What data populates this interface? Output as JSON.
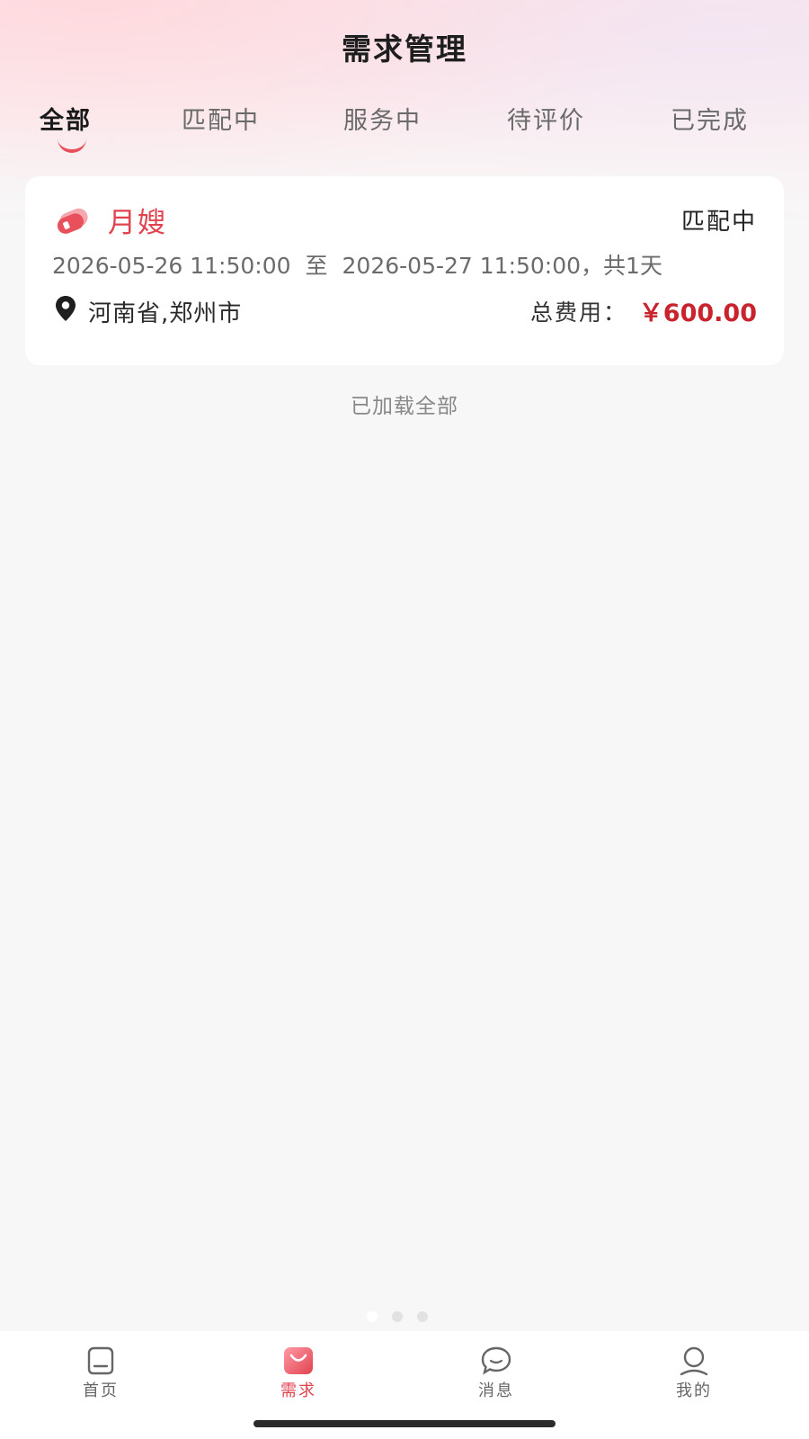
{
  "header": {
    "title": "需求管理"
  },
  "tabs": [
    {
      "label": "全部",
      "active": true
    },
    {
      "label": "匹配中",
      "active": false
    },
    {
      "label": "服务中",
      "active": false
    },
    {
      "label": "待评价",
      "active": false
    },
    {
      "label": "已完成",
      "active": false
    }
  ],
  "orders": [
    {
      "service_icon": "service-tag-icon",
      "service_name": "月嫂",
      "status": "匹配中",
      "start_time": "2026-05-26 11:50:00",
      "range_separator": "至",
      "end_time": "2026-05-27 11:50:00",
      "duration": "，共1天",
      "location_icon": "location-pin-icon",
      "location": "河南省,郑州市",
      "fee_label": "总费用：",
      "fee_value": "￥600.00"
    }
  ],
  "list_footer": "已加载全部",
  "pager": {
    "count": 3,
    "active_index": 0
  },
  "bottom_nav": [
    {
      "label": "首页",
      "icon": "home-icon",
      "active": false
    },
    {
      "label": "需求",
      "icon": "bag-icon",
      "active": true
    },
    {
      "label": "消息",
      "icon": "chat-bubble-icon",
      "active": false
    },
    {
      "label": "我的",
      "icon": "user-icon",
      "active": false
    }
  ],
  "colors": {
    "accent": "#e0434f",
    "price": "#c9232e",
    "background": "#f7f7f7",
    "header_tint": "#fde8ec"
  }
}
